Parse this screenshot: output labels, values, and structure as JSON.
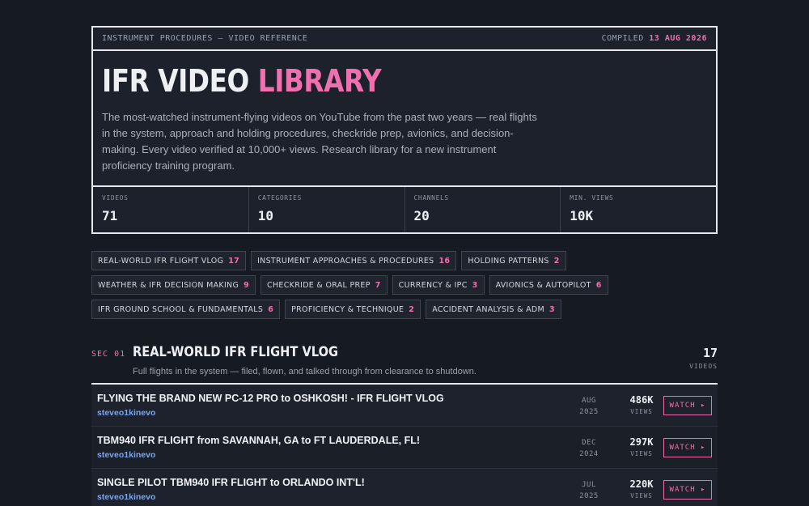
{
  "header": {
    "kicker": "INSTRUMENT PROCEDURES — VIDEO REFERENCE",
    "compiled_label": "COMPILED",
    "compiled_date": "13 AUG 2026",
    "title_main": "IFR VIDEO",
    "title_accent": "LIBRARY",
    "description": "The most-watched instrument-flying videos on YouTube from the past two years — real flights in the system, approach and holding procedures, checkride prep, avionics, and decision-making. Every video verified at 10,000+ views. Research library for a new instrument proficiency training program."
  },
  "stats": [
    {
      "label": "VIDEOS",
      "value": "71"
    },
    {
      "label": "CATEGORIES",
      "value": "10"
    },
    {
      "label": "CHANNELS",
      "value": "20"
    },
    {
      "label": "MIN. VIEWS",
      "value": "10K"
    }
  ],
  "categories": [
    {
      "label": "REAL-WORLD IFR FLIGHT VLOG",
      "count": "17"
    },
    {
      "label": "INSTRUMENT APPROACHES & PROCEDURES",
      "count": "16"
    },
    {
      "label": "HOLDING PATTERNS",
      "count": "2"
    },
    {
      "label": "WEATHER & IFR DECISION MAKING",
      "count": "9"
    },
    {
      "label": "CHECKRIDE & ORAL PREP",
      "count": "7"
    },
    {
      "label": "CURRENCY & IPC",
      "count": "3"
    },
    {
      "label": "AVIONICS & AUTOPILOT",
      "count": "6"
    },
    {
      "label": "IFR GROUND SCHOOL & FUNDAMENTALS",
      "count": "6"
    },
    {
      "label": "PROFICIENCY & TECHNIQUE",
      "count": "2"
    },
    {
      "label": "ACCIDENT ANALYSIS & ADM",
      "count": "3"
    }
  ],
  "section": {
    "number": "SEC 01",
    "title": "REAL-WORLD IFR FLIGHT VLOG",
    "subtitle": "Full flights in the system — filed, flown, and talked through from clearance to shutdown.",
    "count": "17",
    "count_label": "VIDEOS",
    "videos": [
      {
        "title": "FLYING THE BRAND NEW PC-12 PRO to OSHKOSH! - IFR FLIGHT VLOG",
        "channel": "steveo1kinevo",
        "month": "AUG",
        "year": "2025",
        "views": "486K",
        "views_label": "VIEWS",
        "watch": "WATCH ▸"
      },
      {
        "title": "TBM940 IFR FLIGHT from SAVANNAH, GA to FT LAUDERDALE, FL!",
        "channel": "steveo1kinevo",
        "month": "DEC",
        "year": "2024",
        "views": "297K",
        "views_label": "VIEWS",
        "watch": "WATCH ▸"
      },
      {
        "title": "SINGLE PILOT TBM940 IFR FLIGHT to ORLANDO INT'L!",
        "channel": "steveo1kinevo",
        "month": "JUL",
        "year": "2025",
        "views": "220K",
        "views_label": "VIEWS",
        "watch": "WATCH ▸"
      }
    ]
  },
  "colors": {
    "accent": "#f06fae",
    "channel": "#7fa6ea",
    "background": "#161a22"
  }
}
